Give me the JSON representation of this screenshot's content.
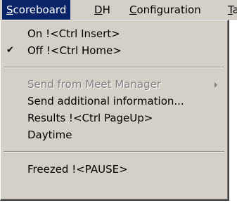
{
  "menubar": {
    "items": [
      {
        "label_first": "S",
        "label_rest": "coreboard"
      },
      {
        "label_first": "D",
        "label_rest": "H"
      },
      {
        "label_first": "C",
        "label_rest": "onfiguration"
      },
      {
        "label_first": "T",
        "label_rest": "a"
      }
    ]
  },
  "menu": {
    "items": [
      {
        "label": "On  !<Ctrl Insert>",
        "checked": false,
        "disabled": false
      },
      {
        "label": "Off  !<Ctrl Home>",
        "checked": true,
        "disabled": false,
        "check_glyph": "✔"
      },
      {
        "label": "Send from Meet Manager",
        "checked": false,
        "disabled": true,
        "submenu": true
      },
      {
        "label": "Send additional information...",
        "checked": false,
        "disabled": false
      },
      {
        "label": "Results  !<Ctrl PageUp>",
        "checked": false,
        "disabled": false
      },
      {
        "label": "Daytime",
        "checked": false,
        "disabled": false
      },
      {
        "label": "Freezed  !<PAUSE>",
        "checked": false,
        "disabled": false
      }
    ]
  }
}
